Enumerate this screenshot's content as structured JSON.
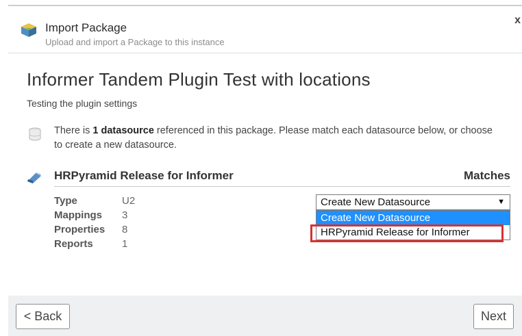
{
  "header": {
    "title": "Import Package",
    "subtitle": "Upload and import a Package to this instance",
    "close_label": "x",
    "icon": "package-icon"
  },
  "package": {
    "title": "Informer Tandem Plugin Test with locations",
    "description": "Testing the plugin settings"
  },
  "datasource_info": {
    "prefix": "There is ",
    "count_label": "1 datasource",
    "suffix": " referenced in this package. Please match each datasource below, or choose to create a new datasource."
  },
  "datasource": {
    "name": "HRPyramid Release for Informer",
    "matches_label": "Matches",
    "properties": [
      {
        "key": "Type",
        "value": "U2"
      },
      {
        "key": "Mappings",
        "value": "3"
      },
      {
        "key": "Properties",
        "value": "8"
      },
      {
        "key": "Reports",
        "value": "1"
      }
    ]
  },
  "match_select": {
    "selected": "Create New Datasource",
    "options": [
      "Create New Datasource",
      "HRPyramid Release for Informer"
    ],
    "highlighted_option_index": 0,
    "annotated_option_index": 1
  },
  "footer": {
    "back_label": "< Back",
    "next_label": "Next"
  },
  "colors": {
    "dropdown_highlight": "#1e90ff",
    "annotation_box": "#d9302e",
    "footer_bg": "#eef0f2"
  }
}
